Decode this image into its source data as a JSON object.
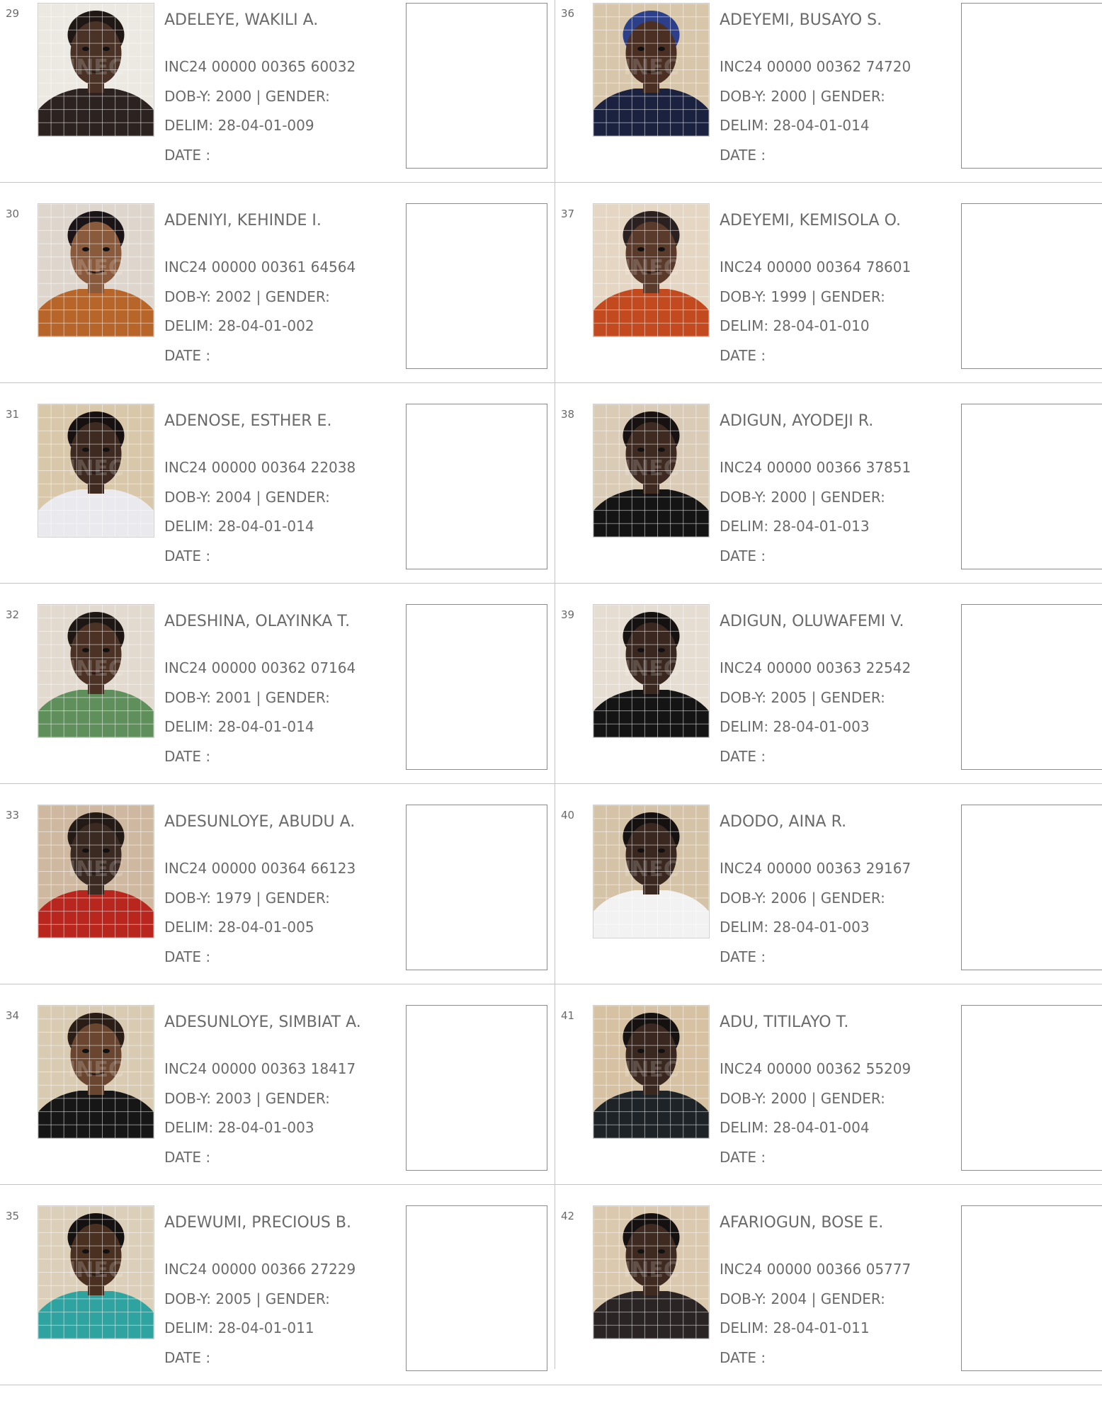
{
  "labels": {
    "dob_prefix": "DOB-Y:",
    "gender_label": "| GENDER:",
    "delim_prefix": "DELIM:",
    "date_label": "DATE :"
  },
  "photo_watermark": "INEC",
  "entries": [
    {
      "no": "29",
      "name": "ADELEYE, WAKILI A.",
      "inc": "INC24 00000 00365 60032",
      "dob": "2000",
      "delim": "28-04-01-009",
      "photo": {
        "bg": "#ece8e2",
        "skin": "#4a3226",
        "hair": "#1f1713",
        "shirt": "#2c2220"
      }
    },
    {
      "no": "30",
      "name": "ADENIYI, KEHINDE I.",
      "inc": "INC24 00000 00361 64564",
      "dob": "2002",
      "delim": "28-04-01-002",
      "photo": {
        "bg": "#ded6cc",
        "skin": "#8a5a3c",
        "hair": "#1b1416",
        "shirt": "#b8652a"
      }
    },
    {
      "no": "31",
      "name": "ADENOSE, ESTHER E.",
      "inc": "INC24 00000 00364 22038",
      "dob": "2004",
      "delim": "28-04-01-014",
      "photo": {
        "bg": "#d8c7a9",
        "skin": "#3e2a20",
        "hair": "#161010",
        "shirt": "#e9e9ee"
      }
    },
    {
      "no": "32",
      "name": "ADESHINA, OLAYINKA T.",
      "inc": "INC24 00000 00362 07164",
      "dob": "2001",
      "delim": "28-04-01-014",
      "photo": {
        "bg": "#e2d9cf",
        "skin": "#4b3224",
        "hair": "#1e1612",
        "shirt": "#5f8f5a"
      }
    },
    {
      "no": "33",
      "name": "ADESUNLOYE, ABUDU A.",
      "inc": "INC24 00000 00364 66123",
      "dob": "1979",
      "delim": "28-04-01-005",
      "photo": {
        "bg": "#cfb8a0",
        "skin": "#3b2a22",
        "hair": "#231a16",
        "shirt": "#b8261d"
      }
    },
    {
      "no": "34",
      "name": "ADESUNLOYE, SIMBIAT A.",
      "inc": "INC24 00000 00363 18417",
      "dob": "2003",
      "delim": "28-04-01-003",
      "photo": {
        "bg": "#d9cab2",
        "skin": "#6a4630",
        "hair": "#2a1d16",
        "shirt": "#161616"
      }
    },
    {
      "no": "35",
      "name": "ADEWUMI, PRECIOUS B.",
      "inc": "INC24 00000 00366 27229",
      "dob": "2005",
      "delim": "28-04-01-011",
      "photo": {
        "bg": "#dccfba",
        "skin": "#4a3020",
        "hair": "#161111",
        "shirt": "#2fa3a0"
      }
    },
    {
      "no": "36",
      "name": "ADEYEMI, BUSAYO S.",
      "inc": "INC24 00000 00362 74720",
      "dob": "2000",
      "delim": "28-04-01-014",
      "photo": {
        "bg": "#d8c6aa",
        "skin": "#4b2f22",
        "hair": "#2b3f8a",
        "shirt": "#1a2240"
      }
    },
    {
      "no": "37",
      "name": "ADEYEMI, KEMISOLA O.",
      "inc": "INC24 00000 00364 78601",
      "dob": "1999",
      "delim": "28-04-01-010",
      "photo": {
        "bg": "#e4d6c2",
        "skin": "#5a3a2a",
        "hair": "#2a2020",
        "shirt": "#c24a1e"
      }
    },
    {
      "no": "38",
      "name": "ADIGUN, AYODEJI R.",
      "inc": "INC24 00000 00366 37851",
      "dob": "2000",
      "delim": "28-04-01-013",
      "photo": {
        "bg": "#d9cbb6",
        "skin": "#3e2a20",
        "hair": "#171111",
        "shirt": "#141414"
      }
    },
    {
      "no": "39",
      "name": "ADIGUN, OLUWAFEMI V.",
      "inc": "INC24 00000 00363 22542",
      "dob": "2005",
      "delim": "28-04-01-003",
      "photo": {
        "bg": "#e6ddd2",
        "skin": "#3a2820",
        "hair": "#161111",
        "shirt": "#141414"
      }
    },
    {
      "no": "40",
      "name": "ADODO, AINA R.",
      "inc": "INC24 00000 00363 29167",
      "dob": "2006",
      "delim": "28-04-01-003",
      "photo": {
        "bg": "#d5c3a8",
        "skin": "#3a2820",
        "hair": "#161111",
        "shirt": "#f2f2f2"
      }
    },
    {
      "no": "41",
      "name": "ADU, TITILAYO T.",
      "inc": "INC24 00000 00362 55209",
      "dob": "2000",
      "delim": "28-04-01-004",
      "photo": {
        "bg": "#d6c2a2",
        "skin": "#3a2820",
        "hair": "#161111",
        "shirt": "#1d2326"
      }
    },
    {
      "no": "42",
      "name": "AFARIOGUN, BOSE E.",
      "inc": "INC24 00000 00366 05777",
      "dob": "2004",
      "delim": "28-04-01-011",
      "photo": {
        "bg": "#dac9ae",
        "skin": "#3e2a20",
        "hair": "#161111",
        "shirt": "#2a2424"
      }
    }
  ]
}
